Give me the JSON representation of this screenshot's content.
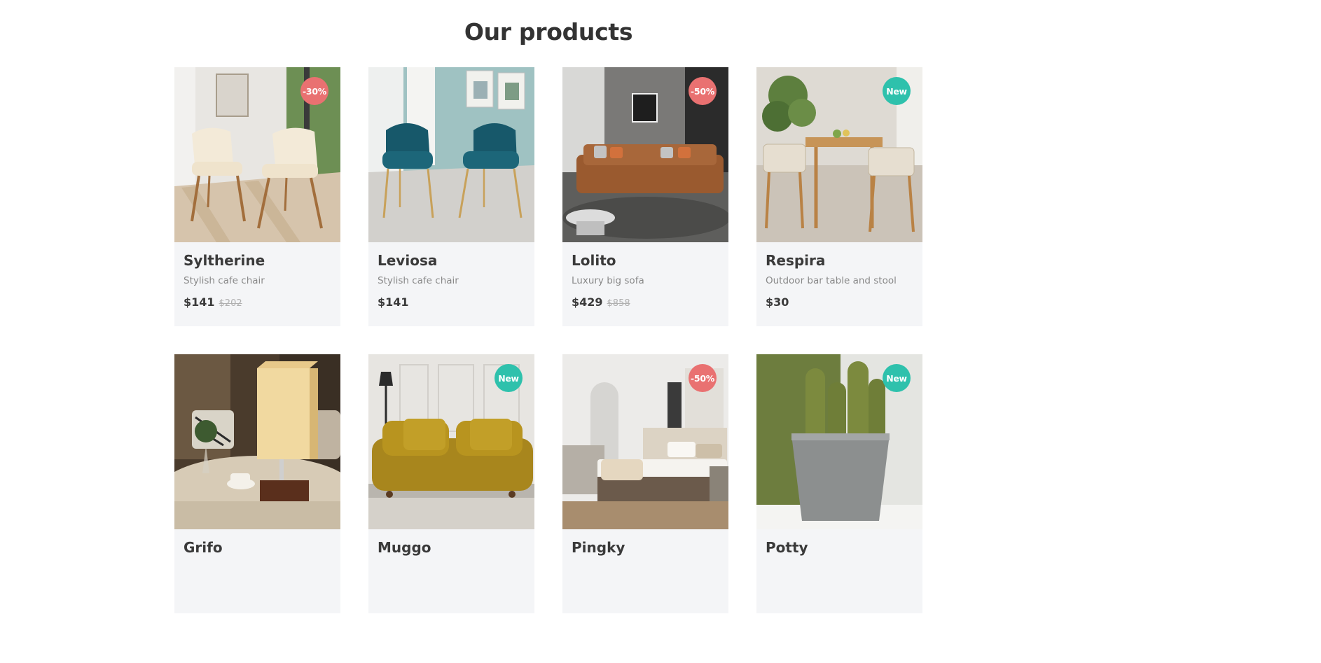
{
  "section": {
    "title": "Our products"
  },
  "colors": {
    "sale_badge": "#e97171",
    "new_badge": "#2ec1ac",
    "card_bg": "#f4f5f7"
  },
  "products": [
    {
      "name": "Syltherine",
      "desc": "Stylish cafe chair",
      "price": "$141",
      "old_price": "$202",
      "badge": "-30%",
      "badge_type": "sale",
      "image": "cream-chairs-image"
    },
    {
      "name": "Leviosa",
      "desc": "Stylish cafe chair",
      "price": "$141",
      "old_price": "",
      "badge": "",
      "badge_type": "",
      "image": "teal-chairs-image"
    },
    {
      "name": "Lolito",
      "desc": "Luxury big sofa",
      "price": "$429",
      "old_price": "$858",
      "badge": "-50%",
      "badge_type": "sale",
      "image": "leather-sofa-image"
    },
    {
      "name": "Respira",
      "desc": "Outdoor bar table and stool",
      "price": "$30",
      "old_price": "",
      "badge": "New",
      "badge_type": "new",
      "image": "bar-table-image"
    },
    {
      "name": "Grifo",
      "desc": "",
      "price": "",
      "old_price": "",
      "badge": "",
      "badge_type": "",
      "image": "table-lamp-image"
    },
    {
      "name": "Muggo",
      "desc": "",
      "price": "",
      "old_price": "",
      "badge": "New",
      "badge_type": "new",
      "image": "mustard-sofa-image"
    },
    {
      "name": "Pingky",
      "desc": "",
      "price": "",
      "old_price": "",
      "badge": "-50%",
      "badge_type": "sale",
      "image": "bedroom-image"
    },
    {
      "name": "Potty",
      "desc": "",
      "price": "",
      "old_price": "",
      "badge": "New",
      "badge_type": "new",
      "image": "cactus-pot-image"
    }
  ]
}
